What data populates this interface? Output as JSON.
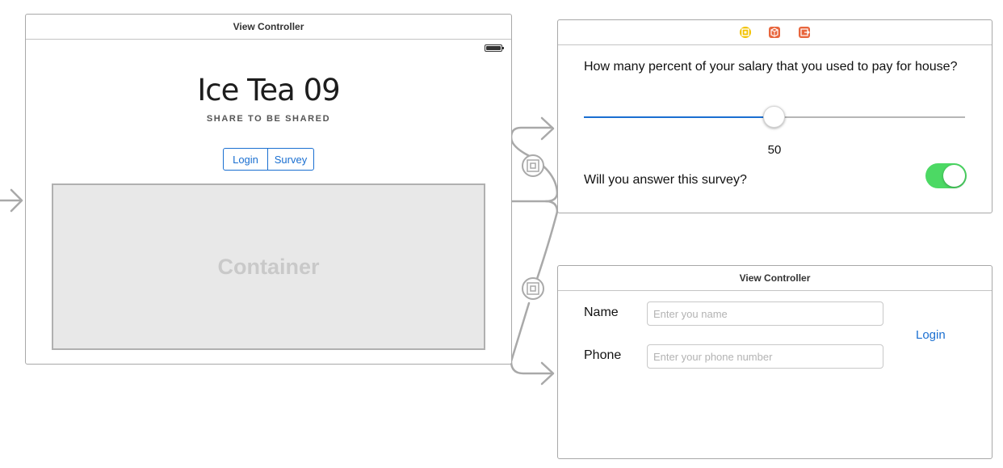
{
  "main_scene": {
    "title": "View Controller",
    "app_title": "Ice Tea 09",
    "app_subtitle": "SHARE TO BE SHARED",
    "segments": [
      "Login",
      "Survey"
    ],
    "container_label": "Container"
  },
  "survey_scene": {
    "toolbar_icons": [
      "view-controller-icon",
      "first-responder-icon",
      "exit-icon"
    ],
    "question": "How many percent of your salary that you used to pay for house?",
    "slider": {
      "value": 50,
      "min": 0,
      "max": 100
    },
    "slider_value_label": "50",
    "toggle_label": "Will you answer this survey?",
    "toggle_on": true
  },
  "login_scene": {
    "title": "View Controller",
    "name_label": "Name",
    "name_placeholder": "Enter you name",
    "phone_label": "Phone",
    "phone_placeholder": "Enter your phone number",
    "login_button": "Login"
  },
  "colors": {
    "accent": "#1a6fd1",
    "toggle_on": "#4cd964",
    "connector": "#a9a9a9"
  }
}
